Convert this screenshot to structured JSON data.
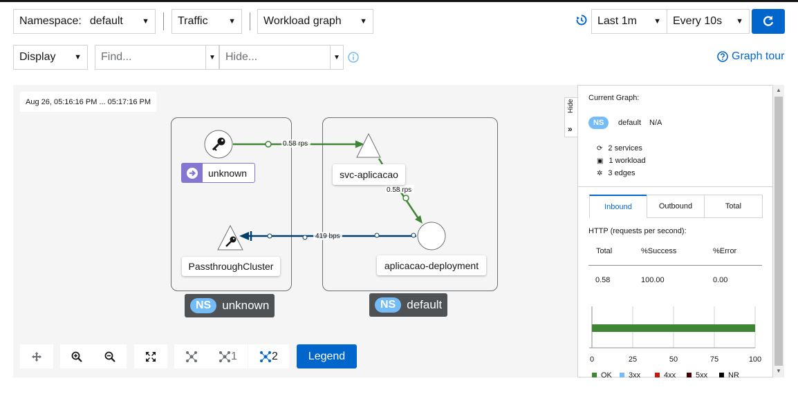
{
  "toolbar": {
    "namespace_label": "Namespace:",
    "namespace_value": "default",
    "traffic_label": "Traffic",
    "graph_type": "Workload graph",
    "duration": "Last 1m",
    "refresh_interval": "Every 10s",
    "display_label": "Display",
    "find_placeholder": "Find...",
    "hide_placeholder": "Hide...",
    "graph_tour": "Graph tour"
  },
  "graph": {
    "timestamp": "Aug 26, 05:16:16 PM ... 05:17:16 PM",
    "nodes": {
      "unknown": "unknown",
      "svc": "svc-aplicacao",
      "passthrough": "PassthroughCluster",
      "deployment": "aplicacao-deployment"
    },
    "edges": {
      "unknown_to_svc": "0.58 rps",
      "svc_to_deployment": "0.58 rps",
      "deployment_to_passthrough": "419 bps"
    },
    "namespaces": {
      "badge": "NS",
      "unknown": "unknown",
      "default": "default"
    }
  },
  "graph_toolbar": {
    "layout1": "1",
    "layout2": "2",
    "legend": "Legend"
  },
  "side_panel": {
    "hide_label": "Hide",
    "title": "Current Graph:",
    "ns_badge": "NS",
    "ns_name": "default",
    "ns_value": "N/A",
    "services": "2 services",
    "workloads": "1 workload",
    "edges": "3 edges",
    "tabs": [
      "Inbound",
      "Outbound",
      "Total"
    ],
    "http_title": "HTTP (requests per second):",
    "table_headers": [
      "Total",
      "%Success",
      "%Error"
    ],
    "table_row": [
      "0.58",
      "100.00",
      "0.00"
    ],
    "chart": {
      "ticks": [
        "0",
        "25",
        "50",
        "75",
        "100"
      ],
      "legend": [
        "OK",
        "3xx",
        "4xx",
        "5xx",
        "NR"
      ]
    }
  },
  "colors": {
    "accent": "#0066cc",
    "ok": "#3e8635",
    "three_xx": "#73bcf7",
    "four_xx": "#c9190b",
    "five_xx": "#470000",
    "nr": "#000000",
    "edge_tcp": "#003f6b",
    "ns_pill": "#73bcf7"
  },
  "chart_data": {
    "type": "bar",
    "categories": [
      ""
    ],
    "series": [
      {
        "name": "OK",
        "values": [
          100
        ]
      },
      {
        "name": "3xx",
        "values": [
          0
        ]
      },
      {
        "name": "4xx",
        "values": [
          0
        ]
      },
      {
        "name": "5xx",
        "values": [
          0
        ]
      },
      {
        "name": "NR",
        "values": [
          0
        ]
      }
    ],
    "xlim": [
      0,
      100
    ],
    "ticks": [
      0,
      25,
      50,
      75,
      100
    ]
  }
}
